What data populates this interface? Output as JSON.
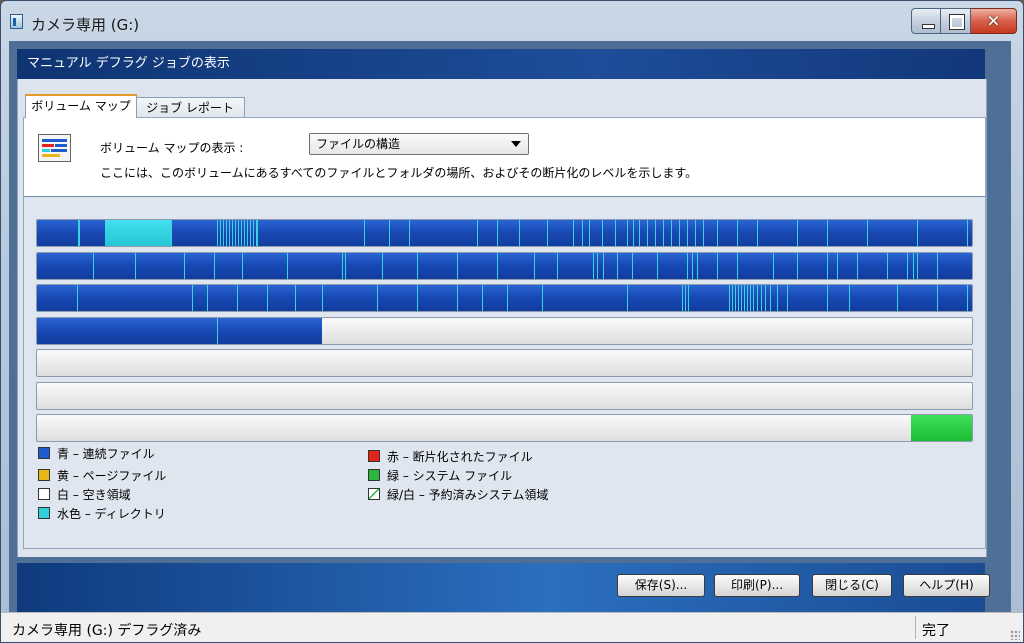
{
  "window": {
    "title": "カメラ専用 (G:)"
  },
  "header": {
    "title": "マニュアル デフラグ ジョブの表示"
  },
  "tabs": [
    {
      "label": "ボリューム マップ",
      "active": true
    },
    {
      "label": "ジョブ レポート",
      "active": false
    }
  ],
  "view": {
    "label": "ボリューム マップの表示 :",
    "selected": "ファイルの構造",
    "description": "ここには、このボリュームにあるすべてのファイルとフォルダの場所、およびその断片化のレベルを示します。"
  },
  "volume_map": {
    "rows": [
      {
        "blue_fill": 1.0,
        "green_fill": 0
      },
      {
        "blue_fill": 1.0,
        "green_fill": 0
      },
      {
        "blue_fill": 1.0,
        "green_fill": 0
      },
      {
        "blue_fill": 0.305,
        "green_fill": 0
      },
      {
        "blue_fill": 0,
        "green_fill": 0
      },
      {
        "blue_fill": 0,
        "green_fill": 0
      },
      {
        "blue_fill": 0,
        "green_fill": 0.065
      }
    ]
  },
  "legend": {
    "items": [
      {
        "label": "青 – 連続ファイル",
        "color": "#1f5ccc"
      },
      {
        "label": "黄 – ページファイル",
        "color": "#e8b51a"
      },
      {
        "label": "白 – 空き領域",
        "color": "#ffffff"
      },
      {
        "label": "水色 – ディレクトリ",
        "color": "#2fd0dc"
      },
      {
        "label": "赤 – 断片化されたファイル",
        "color": "#e2231a"
      },
      {
        "label": "緑 – システム ファイル",
        "color": "#2ab83c"
      },
      {
        "label": "緑/白 – 予約済みシステム領域",
        "color": "#ffffff"
      }
    ]
  },
  "buttons": {
    "save": "保存(S)...",
    "print": "印刷(P)...",
    "close": "閉じる(C)",
    "help": "ヘルプ(H)"
  },
  "status": {
    "left": "カメラ専用 (G:) デフラグ済み",
    "right": "完了"
  },
  "colors": {
    "contiguous": "#1f5ccc",
    "directory": "#2fd0dc",
    "system": "#2ab83c",
    "header": "#123a7c"
  }
}
